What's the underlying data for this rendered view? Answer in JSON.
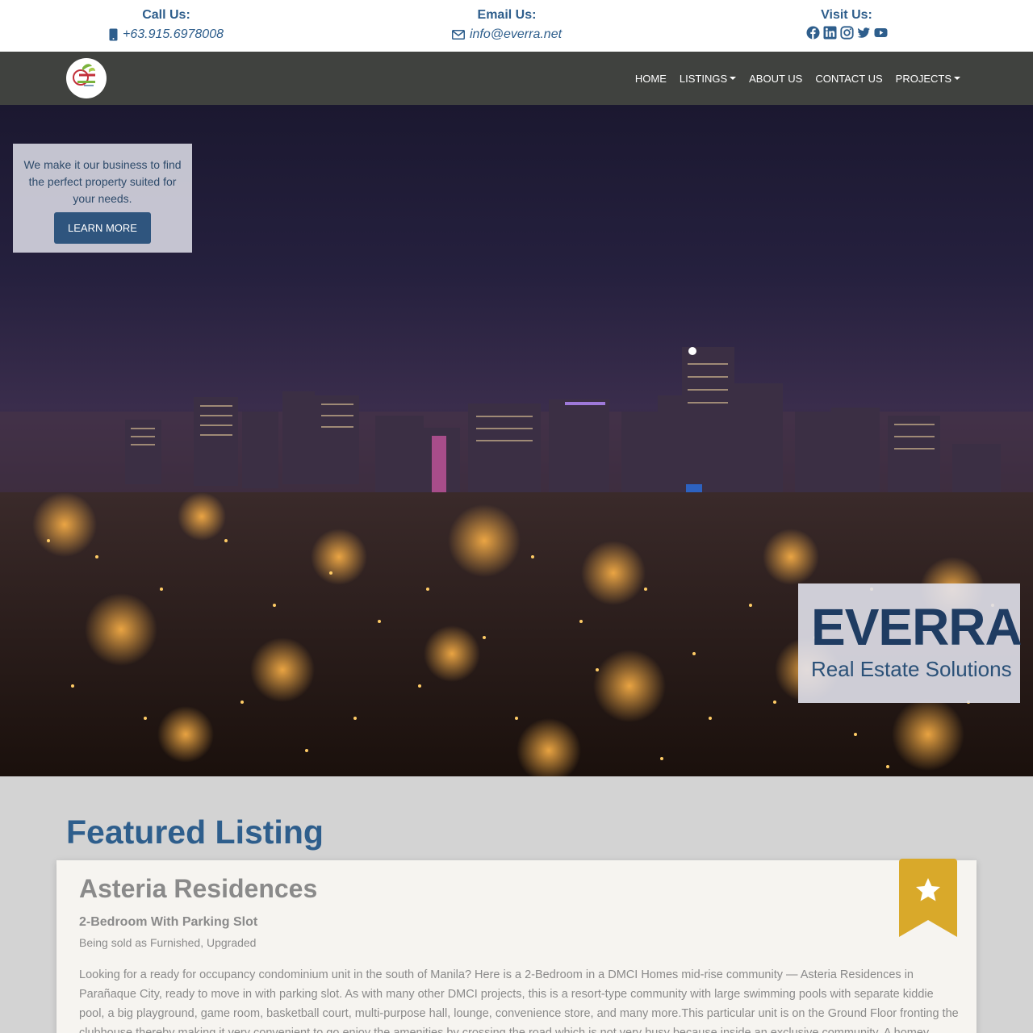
{
  "contact": {
    "call": {
      "label": "Call Us:",
      "value": "+63.915.6978008",
      "icon": "mobile-phone-icon"
    },
    "email": {
      "label": "Email Us:",
      "value": "info@everra.net",
      "icon": "envelope-icon"
    },
    "visit": {
      "label": "Visit Us:",
      "icons": [
        "facebook-icon",
        "linkedin-icon",
        "instagram-icon",
        "twitter-icon",
        "youtube-icon"
      ]
    }
  },
  "nav": {
    "items": [
      {
        "label": "HOME",
        "dropdown": false
      },
      {
        "label": "LISTINGS",
        "dropdown": true
      },
      {
        "label": "ABOUT US",
        "dropdown": false
      },
      {
        "label": "CONTACT US",
        "dropdown": false
      },
      {
        "label": "PROJECTS",
        "dropdown": true
      }
    ]
  },
  "hero": {
    "cta_text": "We make it our business to find the perfect property suited for your needs.",
    "cta_button": "LEARN MORE",
    "brand_title": "EVERRA",
    "brand_subtitle": "Real Estate Solutions"
  },
  "featured": {
    "heading": "Featured Listing",
    "listing": {
      "title": "Asteria Residences",
      "subtitle": "2-Bedroom With Parking Slot",
      "note": "Being sold as Furnished, Upgraded",
      "description": "Looking for a ready for occupancy condominium unit in the south of Manila? Here is a 2-Bedroom in a DMCI Homes mid-rise community — Asteria Residences in Parañaque City, ready to move in with parking slot. As with many other DMCI projects, this is a resort-type community with large swimming pools with separate kiddie pool, a big playground, game room, basketball court, multi-purpose hall, lounge, convenience store, and many more.This particular unit is on the Ground Floor fronting the clubhouse thereby making it very convenient to go enjoy the amenities by crossing the road which is not very busy because inside an exclusive community. A homey place it is, unit owner of Asteria"
    }
  },
  "colors": {
    "primary": "#2e5e8c",
    "navbar": "#40423f",
    "button": "#2f557e",
    "bookmark": "#d9a92a"
  }
}
